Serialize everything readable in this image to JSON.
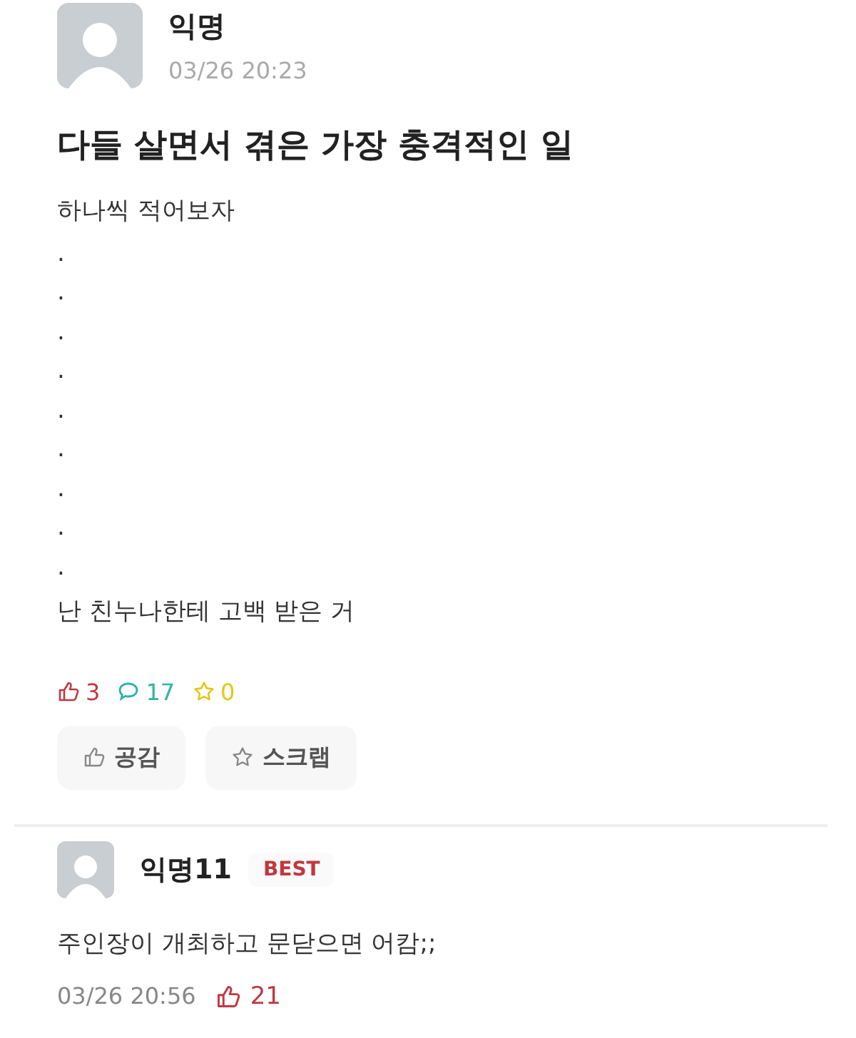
{
  "post": {
    "author": "익명",
    "time": "03/26 20:23",
    "title": "다들 살면서 겪은 가장 충격적인 일",
    "body": [
      "하나씩 적어보자",
      ".",
      ".",
      ".",
      ".",
      ".",
      ".",
      ".",
      ".",
      ".",
      "난 친누나한테 고백 받은 거"
    ],
    "stats": {
      "likes": "3",
      "comments": "17",
      "scraps": "0"
    },
    "buttons": [
      {
        "kind": "like",
        "label": "공감"
      },
      {
        "kind": "scrap",
        "label": "스크랩"
      }
    ]
  },
  "comments": [
    {
      "author": "익명11",
      "badge": "BEST",
      "text": "주인장이 개최하고 문닫으면 어캄;;",
      "time": "03/26 20:56",
      "likes": "21"
    }
  ]
}
